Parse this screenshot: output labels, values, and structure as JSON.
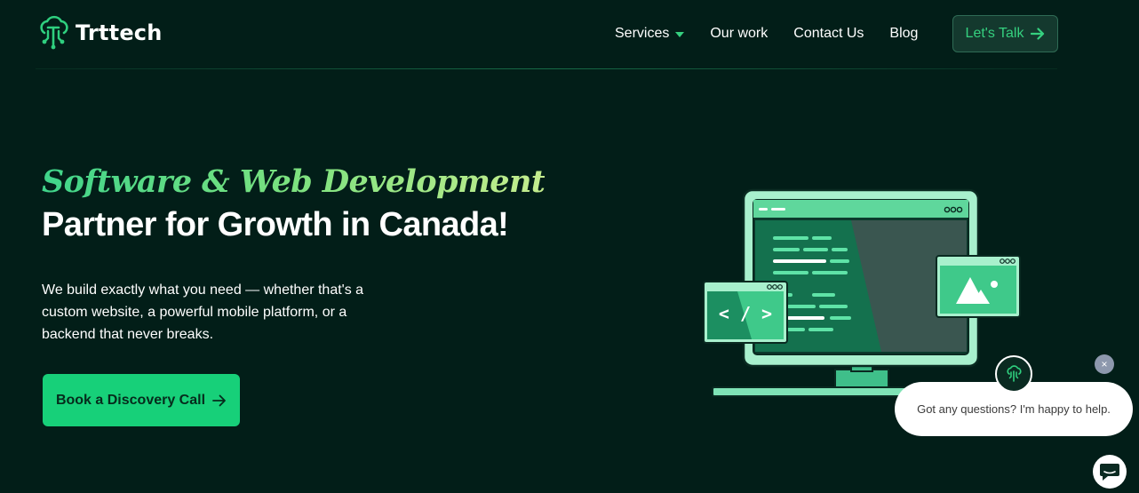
{
  "brand": {
    "name": "Trttech",
    "accent": "#17d079",
    "background": "#021e18"
  },
  "nav": {
    "items": [
      "Services",
      "Our work",
      "Contact Us",
      "Blog"
    ],
    "cta_label": "Let's Talk"
  },
  "hero": {
    "title_line1": "Software & Web Development",
    "title_line2": "Partner for Growth in Canada!",
    "description": "We build exactly what you need — whether that's a custom website, a powerful mobile platform, or a backend that never breaks.",
    "cta_label": "Book a Discovery Call"
  },
  "illustration": {
    "code_label": "< / >"
  },
  "chat": {
    "message": "Got any questions? I'm happy to help.",
    "close_symbol": "×"
  },
  "icons": [
    "tree-circuit-logo-icon",
    "caret-down-icon",
    "arrow-right-icon",
    "code-window-icon",
    "image-window-icon",
    "chat-icon",
    "close-icon"
  ]
}
